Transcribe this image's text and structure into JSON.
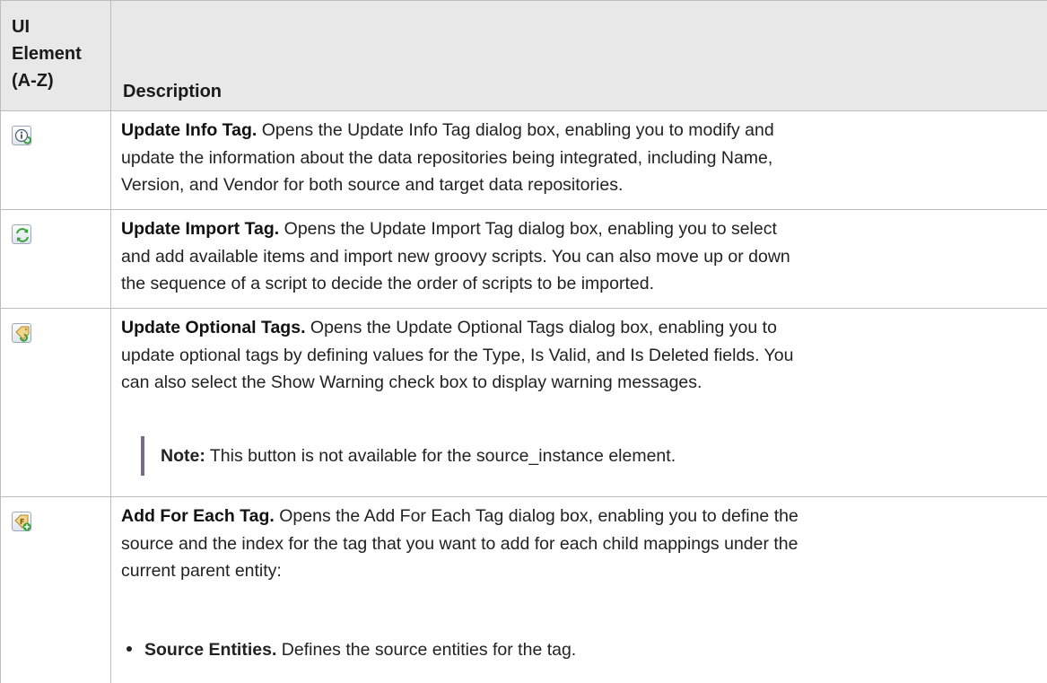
{
  "table": {
    "header": {
      "element_col": [
        "UI",
        "Element",
        "(A-Z)"
      ],
      "description_col": "Description"
    },
    "rows": [
      {
        "icon": "update-info-tag-icon",
        "title": "Update Info Tag.",
        "text_lines": [
          " Opens the Update Info Tag dialog box, enabling you to modify and",
          "update the information about the data repositories being integrated, including Name,",
          "Version, and Vendor for both source and target data repositories."
        ]
      },
      {
        "icon": "update-import-tag-icon",
        "title": "Update Import Tag.",
        "text_lines": [
          " Opens the Update Import Tag dialog box, enabling you to select",
          "and add available items and import new groovy scripts. You can also move up or down",
          "the sequence of a script to decide the order of scripts to be imported."
        ]
      },
      {
        "icon": "update-optional-tags-icon",
        "title": "Update Optional Tags.",
        "text_lines": [
          " Opens the Update Optional Tags dialog box, enabling you to",
          "update optional tags by defining values for the Type, Is Valid, and Is Deleted fields. You",
          "can also select the Show Warning check box to display warning messages."
        ],
        "note_label": "Note:",
        "note_text": " This button is not available for the source_instance element."
      },
      {
        "icon": "add-for-each-tag-icon",
        "title": "Add For Each Tag.",
        "text_lines": [
          " Opens the Add For Each Tag dialog box, enabling you to define the",
          "source and the index for the tag that you want to add for each child mappings under the",
          "current parent entity:"
        ],
        "bullets": [
          {
            "label": "Source Entities.",
            "text": " Defines the source entities for the tag."
          }
        ]
      }
    ]
  }
}
